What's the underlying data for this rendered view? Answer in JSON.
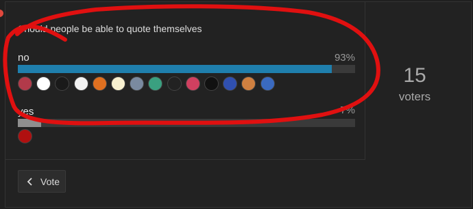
{
  "poll": {
    "question": "Should people be able to quote themselves",
    "options": [
      {
        "label": "no",
        "percent": 93,
        "percent_text": "93%",
        "bar_color": "#1f7fad"
      },
      {
        "label": "yes",
        "percent": 7,
        "percent_text": "7%",
        "bar_color": "#8f8f8f"
      }
    ],
    "voters_count": "15",
    "voters_label": "voters",
    "vote_button_label": "Vote"
  },
  "colors": {
    "background": "#202020",
    "annotation_red": "#e01010",
    "avatar_colors_no": [
      "#b23a4a",
      "#ffffff",
      "#1a1a1a",
      "#f2f2f2",
      "#e07020",
      "#f7f0d0",
      "#7a8aa0",
      "#3aa080",
      "#222222",
      "#d04060",
      "#111111",
      "#3050b0",
      "#d08040",
      "#3a6ac0"
    ],
    "avatar_colors_yes": [
      "#b01010"
    ]
  }
}
